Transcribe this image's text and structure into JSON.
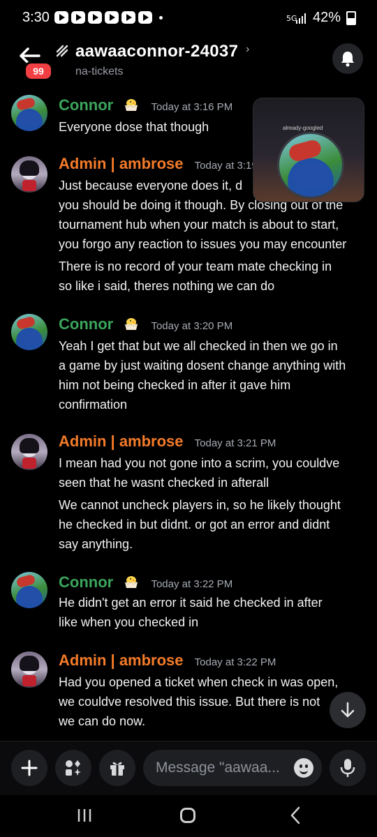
{
  "status_bar": {
    "time": "3:30",
    "battery": "42%"
  },
  "header": {
    "unread_badge": "99",
    "title": "aawaaconnor-24037",
    "chevron": "›",
    "subtitle": "na-tickets"
  },
  "messages": [
    {
      "author": "Connor",
      "emoji": "hatching-chick-icon",
      "timestamp": "Today at 3:16 PM",
      "lines": [
        "Everyone dose that though"
      ]
    },
    {
      "author": "Admin | ambrose",
      "timestamp": "Today at 3:19",
      "lines": [
        "Just because everyone does it, d",
        "you should be doing it though. By closing out of the",
        "tournament hub when your match is about to start,",
        "you forgo any reaction to issues you may encounter"
      ],
      "followup": [
        "There is no record of your team mate checking in",
        "so like i said, theres nothing we can do"
      ]
    },
    {
      "author": "Connor",
      "timestamp": "Today at 3:20 PM",
      "lines": [
        "Yeah I get that but we all checked in then we go in",
        "a game by just waiting dosent change anything with",
        "him not being checked in after it gave him",
        "confirmation"
      ]
    },
    {
      "author": "Admin | ambrose",
      "timestamp": "Today at 3:21 PM",
      "lines": [
        "I mean had you not gone into a scrim, you couldve",
        "seen that he wasnt checked in afterall"
      ],
      "followup": [
        "We cannot uncheck players in, so he likely thought",
        "he checked in but didnt. or got an error and didnt",
        "say anything."
      ]
    },
    {
      "author": "Connor",
      "timestamp": "Today at 3:22 PM",
      "lines": [
        "He didn't get an error it said he checked in after",
        "like when you checked in"
      ]
    },
    {
      "author": "Admin | ambrose",
      "timestamp": "Today at 3:22 PM",
      "lines": [
        "Had you opened a ticket when check in was open,",
        "we couldve resolved this issue. But there is not",
        "we can do now."
      ]
    }
  ],
  "pip": {
    "label": "already-googled"
  },
  "composer": {
    "placeholder": "Message \"aawaa..."
  },
  "colors": {
    "connor": "#3ba55c",
    "admin": "#f47b2a",
    "background": "#000000"
  }
}
